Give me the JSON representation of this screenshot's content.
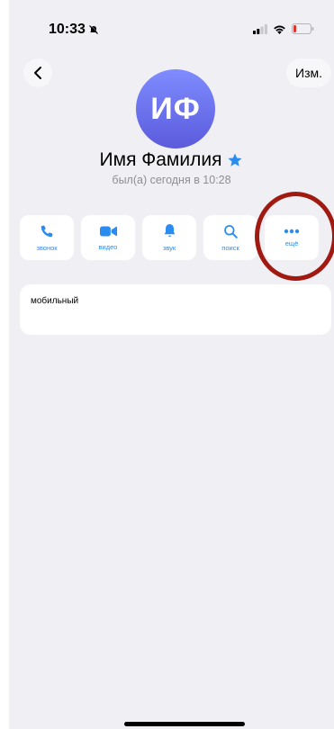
{
  "status_bar": {
    "time": "10:33"
  },
  "nav": {
    "edit_label": "Изм."
  },
  "profile": {
    "initials": "ИФ",
    "name": "Имя Фамилия",
    "last_seen": "был(а) сегодня в 10:28"
  },
  "actions": [
    {
      "label": "звонок",
      "icon": "phone-icon"
    },
    {
      "label": "видео",
      "icon": "video-camera-icon"
    },
    {
      "label": "звук",
      "icon": "bell-icon"
    },
    {
      "label": "поиск",
      "icon": "search-icon"
    },
    {
      "label": "ещё",
      "icon": "more-dots-icon"
    }
  ],
  "info_card": {
    "label": "мобильный"
  },
  "colors": {
    "accent": "#2a8cf0",
    "background": "#efeff4",
    "avatar_top": "#7f8cff",
    "avatar_bottom": "#5b5bdc",
    "highlight_ring": "#a11a12",
    "star": "#2a8cf0"
  }
}
